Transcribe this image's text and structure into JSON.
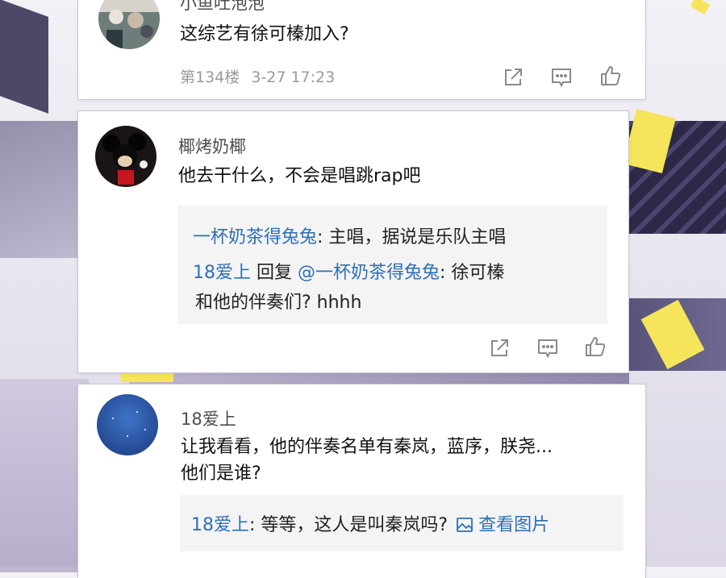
{
  "comments": [
    {
      "username": "小鱼吐泡泡",
      "text": "这综艺有徐可榛加入?",
      "floor": "第134楼",
      "time": "3-27 17:23"
    },
    {
      "username": "椰烤奶椰",
      "text": "他去干什么，不会是唱跳rap吧",
      "replies": [
        {
          "author": "一杯奶茶得兔兔",
          "sep": ": ",
          "text": "主唱，据说是乐队主唱"
        },
        {
          "author": "18爱上",
          "reply_word": " 回复 ",
          "target": "@一杯奶茶得兔兔",
          "sep": ": ",
          "text": "徐可榛",
          "text2": "和他的伴奏们? hhhh"
        }
      ]
    },
    {
      "username": "18爱上",
      "text_line1": "让我看看，他的伴奏名单有秦岚，蓝序，朕尧...",
      "text_line2": "他们是谁?",
      "replies": [
        {
          "author": "18爱上",
          "sep": ": ",
          "text": "等等，这人是叫秦岚吗?",
          "link": "查看图片"
        }
      ]
    }
  ],
  "icons": [
    "share-icon",
    "comment-icon",
    "like-icon",
    "image-link-icon"
  ],
  "colors": {
    "link_blue": "#2f6fb3",
    "meta_gray": "#9a9a9a",
    "reply_bg": "#f4f4f5"
  }
}
